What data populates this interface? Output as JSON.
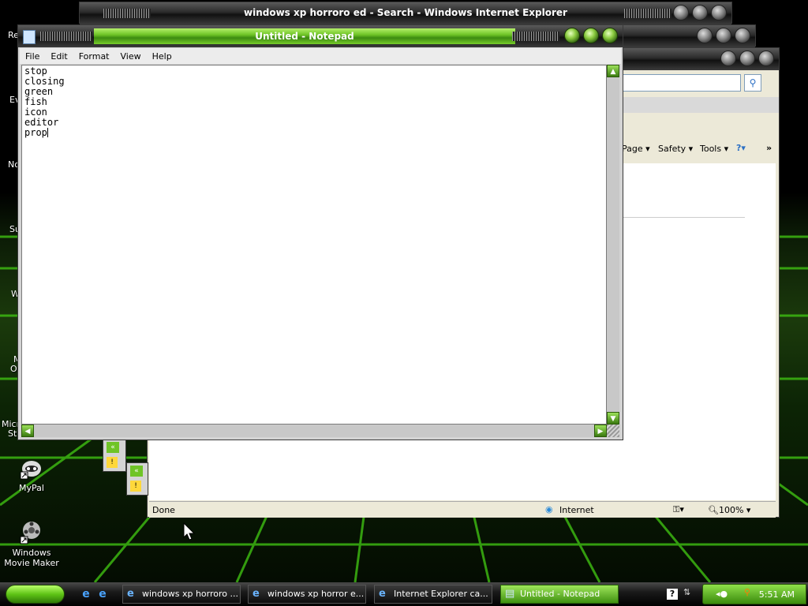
{
  "desktop": {
    "icons": [
      {
        "label": "MyPal",
        "icon": "mypal-icon"
      },
      {
        "label": "Windows Movie Maker",
        "icon": "movie-maker-icon"
      }
    ],
    "partial_labels": [
      "Re",
      "Ev",
      "No",
      "Su",
      "W",
      "M",
      "O",
      "Micro",
      "St"
    ]
  },
  "ie_back": {
    "title": "windows xp horroro ed - Search - Windows Internet Explorer",
    "toolbar": {
      "page": "Page",
      "safety": "Safety",
      "tools": "Tools",
      "more": "»"
    },
    "status": {
      "text": "Done",
      "zone": "Internet",
      "zoom": "100%"
    }
  },
  "notepad": {
    "title": "Untitled - Notepad",
    "menu": [
      "File",
      "Edit",
      "Format",
      "View",
      "Help"
    ],
    "content_lines": [
      "stop",
      "closing",
      "green",
      "fish",
      "icon",
      "editor",
      "prop"
    ]
  },
  "taskbar": {
    "tasks": [
      {
        "label": "windows xp horroro ...",
        "active": false
      },
      {
        "label": "windows xp horror e...",
        "active": false
      },
      {
        "label": "Internet Explorer ca...",
        "active": false
      },
      {
        "label": "Untitled - Notepad",
        "active": true
      }
    ],
    "clock": "5:51 AM"
  },
  "colors": {
    "accent": "#6fc427",
    "titlebar_inactive": "#1a1a1a"
  }
}
